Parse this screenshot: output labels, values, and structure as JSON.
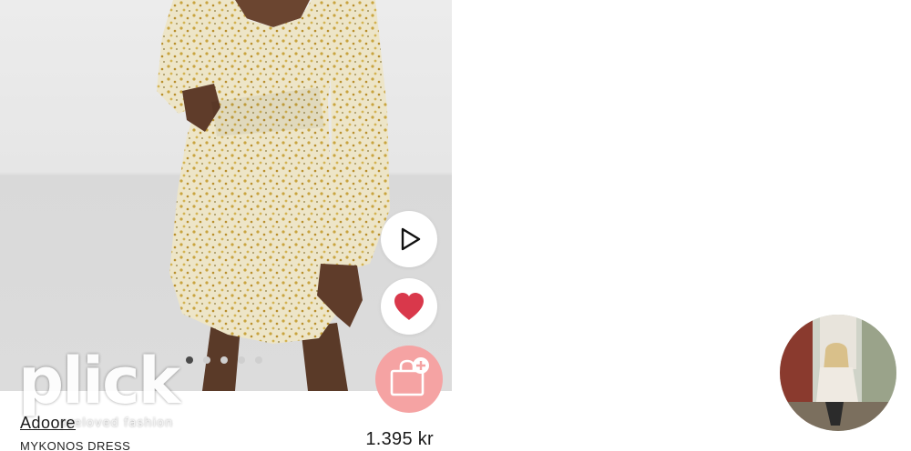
{
  "product": {
    "brand": "Adoore",
    "name": "MYKONOS DRESS",
    "price": "1.395 kr",
    "image_dots": {
      "count": 5,
      "active_index": 0
    }
  },
  "actions": {
    "play_icon": "play-icon",
    "favorite_icon": "heart-icon",
    "cart_icon": "shopping-bag-plus-icon"
  },
  "watermark": {
    "logo": "plick",
    "tagline": "preloved fashion"
  },
  "colors": {
    "heart": "#d9384b",
    "cart_button": "#f5a3a3",
    "dress_base": "#ede5c8",
    "dress_print": "#c9a43f"
  }
}
